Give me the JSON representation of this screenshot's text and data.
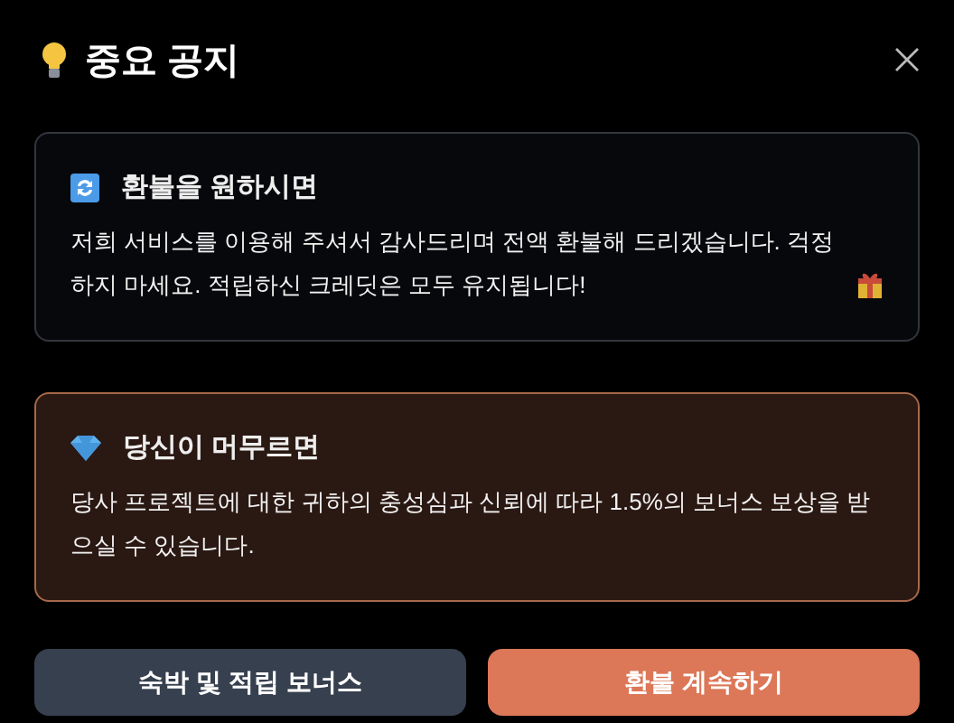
{
  "dialog": {
    "title": "중요 공지"
  },
  "cards": [
    {
      "kind": "neutral",
      "heading": "환불을 원하시면",
      "body": "저희 서비스를 이용해 주셔서 감사드리며 전액 환불해 드리겠습니다. 걱정하지 마세요. 적립하신 크레딧은 모두 유지됩니다!"
    },
    {
      "kind": "highlight",
      "heading": "당신이 머무르면",
      "body": "당사 프로젝트에 대한 귀하의 충성심과 신뢰에 따라 1.5%의 보너스 보상을 받으실 수 있습니다."
    }
  ],
  "buttons": [
    {
      "label": "숙박 및 적립 보너스",
      "kind": "secondary"
    },
    {
      "label": "환불 계속하기",
      "kind": "primary"
    }
  ]
}
